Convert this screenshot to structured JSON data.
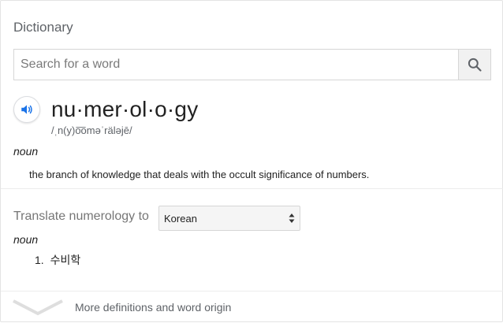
{
  "panel": {
    "title": "Dictionary"
  },
  "search": {
    "placeholder": "Search for a word",
    "value": "",
    "button_icon": "search-icon"
  },
  "entry": {
    "audio_icon": "speaker-icon",
    "headword": "nu·mer·ol·o·gy",
    "phonetic": "/ˌn(y)o͞oməˈräləjē/",
    "part_of_speech": "noun",
    "definition": "the branch of knowledge that deals with the occult significance of numbers."
  },
  "translate": {
    "label": "Translate numerology to",
    "selected_language": "Korean",
    "part_of_speech": "noun",
    "items": [
      {
        "number": "1.",
        "text": "수비학"
      }
    ]
  },
  "footer": {
    "more_label": "More definitions and word origin",
    "expand_icon": "chevron-down-icon"
  },
  "colors": {
    "accent_blue": "#1a73e8",
    "muted_text": "#5f6368",
    "border": "#d6d6d6"
  }
}
